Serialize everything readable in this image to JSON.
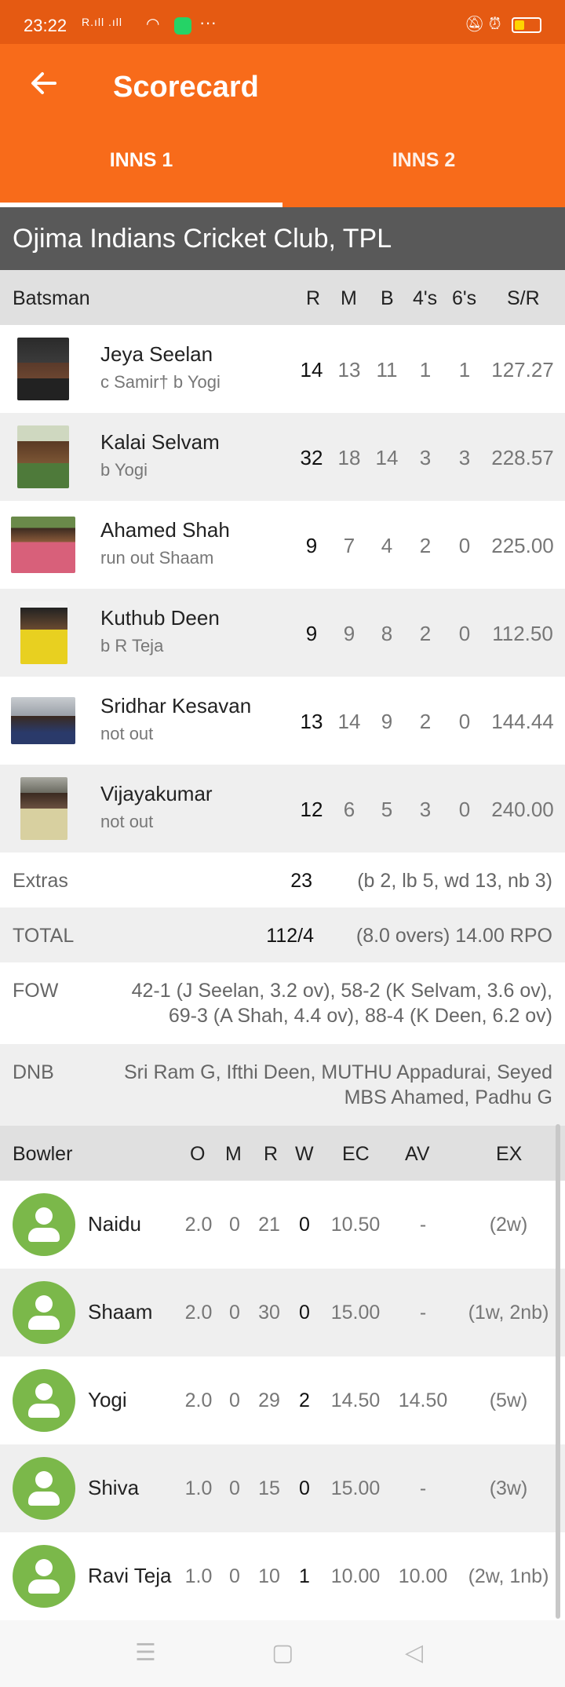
{
  "status": {
    "time": "23:22",
    "signal": "R.ıll .ıll",
    "dots": "···"
  },
  "appbar": {
    "title": "Scorecard",
    "back_icon": "arrow-left-icon"
  },
  "tabs": [
    {
      "label": "INNS 1"
    },
    {
      "label": "INNS 2"
    }
  ],
  "team": "Ojima Indians Cricket Club, TPL",
  "batting_header": {
    "label": "Batsman",
    "r": "R",
    "m": "M",
    "b": "B",
    "fours": "4's",
    "sixes": "6's",
    "sr": "S/R"
  },
  "batsmen": [
    {
      "name": "Jeya Seelan",
      "dismissal": "c Samir† b Yogi",
      "r": "14",
      "m": "13",
      "b": "11",
      "fours": "1",
      "sixes": "1",
      "sr": "127.27"
    },
    {
      "name": "Kalai Selvam",
      "dismissal": "b Yogi",
      "r": "32",
      "m": "18",
      "b": "14",
      "fours": "3",
      "sixes": "3",
      "sr": "228.57"
    },
    {
      "name": "Ahamed Shah",
      "dismissal": "run out Shaam",
      "r": "9",
      "m": "7",
      "b": "4",
      "fours": "2",
      "sixes": "0",
      "sr": "225.00"
    },
    {
      "name": "Kuthub Deen",
      "dismissal": "b R Teja",
      "r": "9",
      "m": "9",
      "b": "8",
      "fours": "2",
      "sixes": "0",
      "sr": "112.50"
    },
    {
      "name": "Sridhar Kesavan",
      "dismissal": "not out",
      "r": "13",
      "m": "14",
      "b": "9",
      "fours": "2",
      "sixes": "0",
      "sr": "144.44"
    },
    {
      "name": "Vijayakumar",
      "dismissal": "not out",
      "r": "12",
      "m": "6",
      "b": "5",
      "fours": "3",
      "sixes": "0",
      "sr": "240.00"
    }
  ],
  "extras": {
    "label": "Extras",
    "value": "23",
    "detail": "(b 2, lb 5, wd 13, nb 3)"
  },
  "total": {
    "label": "TOTAL",
    "value": "112/4",
    "detail": "(8.0 overs) 14.00 RPO"
  },
  "fow": {
    "label": "FOW",
    "line1": "42-1 (J Seelan, 3.2 ov), 58-2 (K Selvam, 3.6 ov),",
    "line2": "69-3 (A Shah, 4.4 ov), 88-4 (K Deen, 6.2 ov)"
  },
  "dnb": {
    "label": "DNB",
    "line1": "Sri Ram G, Ifthi Deen, MUTHU Appadurai, Seyed",
    "line2": "MBS Ahamed, Padhu G"
  },
  "bowling_header": {
    "label": "Bowler",
    "o": "O",
    "m": "M",
    "r": "R",
    "w": "W",
    "ec": "EC",
    "av": "AV",
    "ex": "EX"
  },
  "bowlers": [
    {
      "name": "Naidu",
      "o": "2.0",
      "m": "0",
      "r": "21",
      "w": "0",
      "ec": "10.50",
      "av": "-",
      "ex": "(2w)"
    },
    {
      "name": "Shaam",
      "o": "2.0",
      "m": "0",
      "r": "30",
      "w": "0",
      "ec": "15.00",
      "av": "-",
      "ex": "(1w, 2nb)"
    },
    {
      "name": "Yogi",
      "o": "2.0",
      "m": "0",
      "r": "29",
      "w": "2",
      "ec": "14.50",
      "av": "14.50",
      "ex": "(5w)"
    },
    {
      "name": "Shiva",
      "o": "1.0",
      "m": "0",
      "r": "15",
      "w": "0",
      "ec": "15.00",
      "av": "-",
      "ex": "(3w)"
    },
    {
      "name": "Ravi Teja",
      "o": "1.0",
      "m": "0",
      "r": "10",
      "w": "1",
      "ec": "10.00",
      "av": "10.00",
      "ex": "(2w, 1nb)"
    }
  ],
  "colors": {
    "accent": "#f86b1a",
    "status": "#e55a12",
    "team_bar": "#595959",
    "avatar": "#7bb84a"
  }
}
